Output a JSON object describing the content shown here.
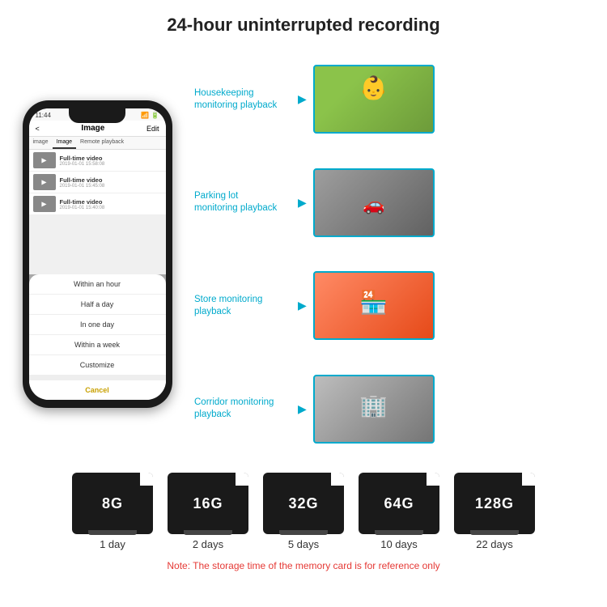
{
  "header": {
    "title": "24-hour uninterrupted recording"
  },
  "phone": {
    "time": "11:44",
    "nav": {
      "back": "<",
      "title": "Image",
      "edit": "Edit"
    },
    "tabs": [
      "image",
      "Image",
      "Remote playback"
    ],
    "videos": [
      {
        "name": "Full-time video",
        "date": "2019-01-01 15:58:08"
      },
      {
        "name": "Full-time video",
        "date": "2019-01-01 15:45:08"
      },
      {
        "name": "Full-time video",
        "date": "2019-01-01 15:40:08"
      }
    ],
    "dropdown": {
      "items": [
        "Within an hour",
        "Half a day",
        "In one day",
        "Within a week",
        "Customize"
      ],
      "cancel": "Cancel"
    }
  },
  "monitoring": {
    "items": [
      {
        "label": "Housekeeping\nmonitoring playback",
        "img_type": "housekeeping"
      },
      {
        "label": "Parking lot\nmonitoring playback",
        "img_type": "parking"
      },
      {
        "label": "Store monitoring\nplayback",
        "img_type": "store"
      },
      {
        "label": "Corridor monitoring\nplayback",
        "img_type": "corridor"
      }
    ]
  },
  "sdcards": [
    {
      "size": "8G",
      "days": "1 day"
    },
    {
      "size": "16G",
      "days": "2 days"
    },
    {
      "size": "32G",
      "days": "5 days"
    },
    {
      "size": "64G",
      "days": "10 days"
    },
    {
      "size": "128G",
      "days": "22 days"
    }
  ],
  "note": "Note: The storage time of the memory card is for reference only"
}
